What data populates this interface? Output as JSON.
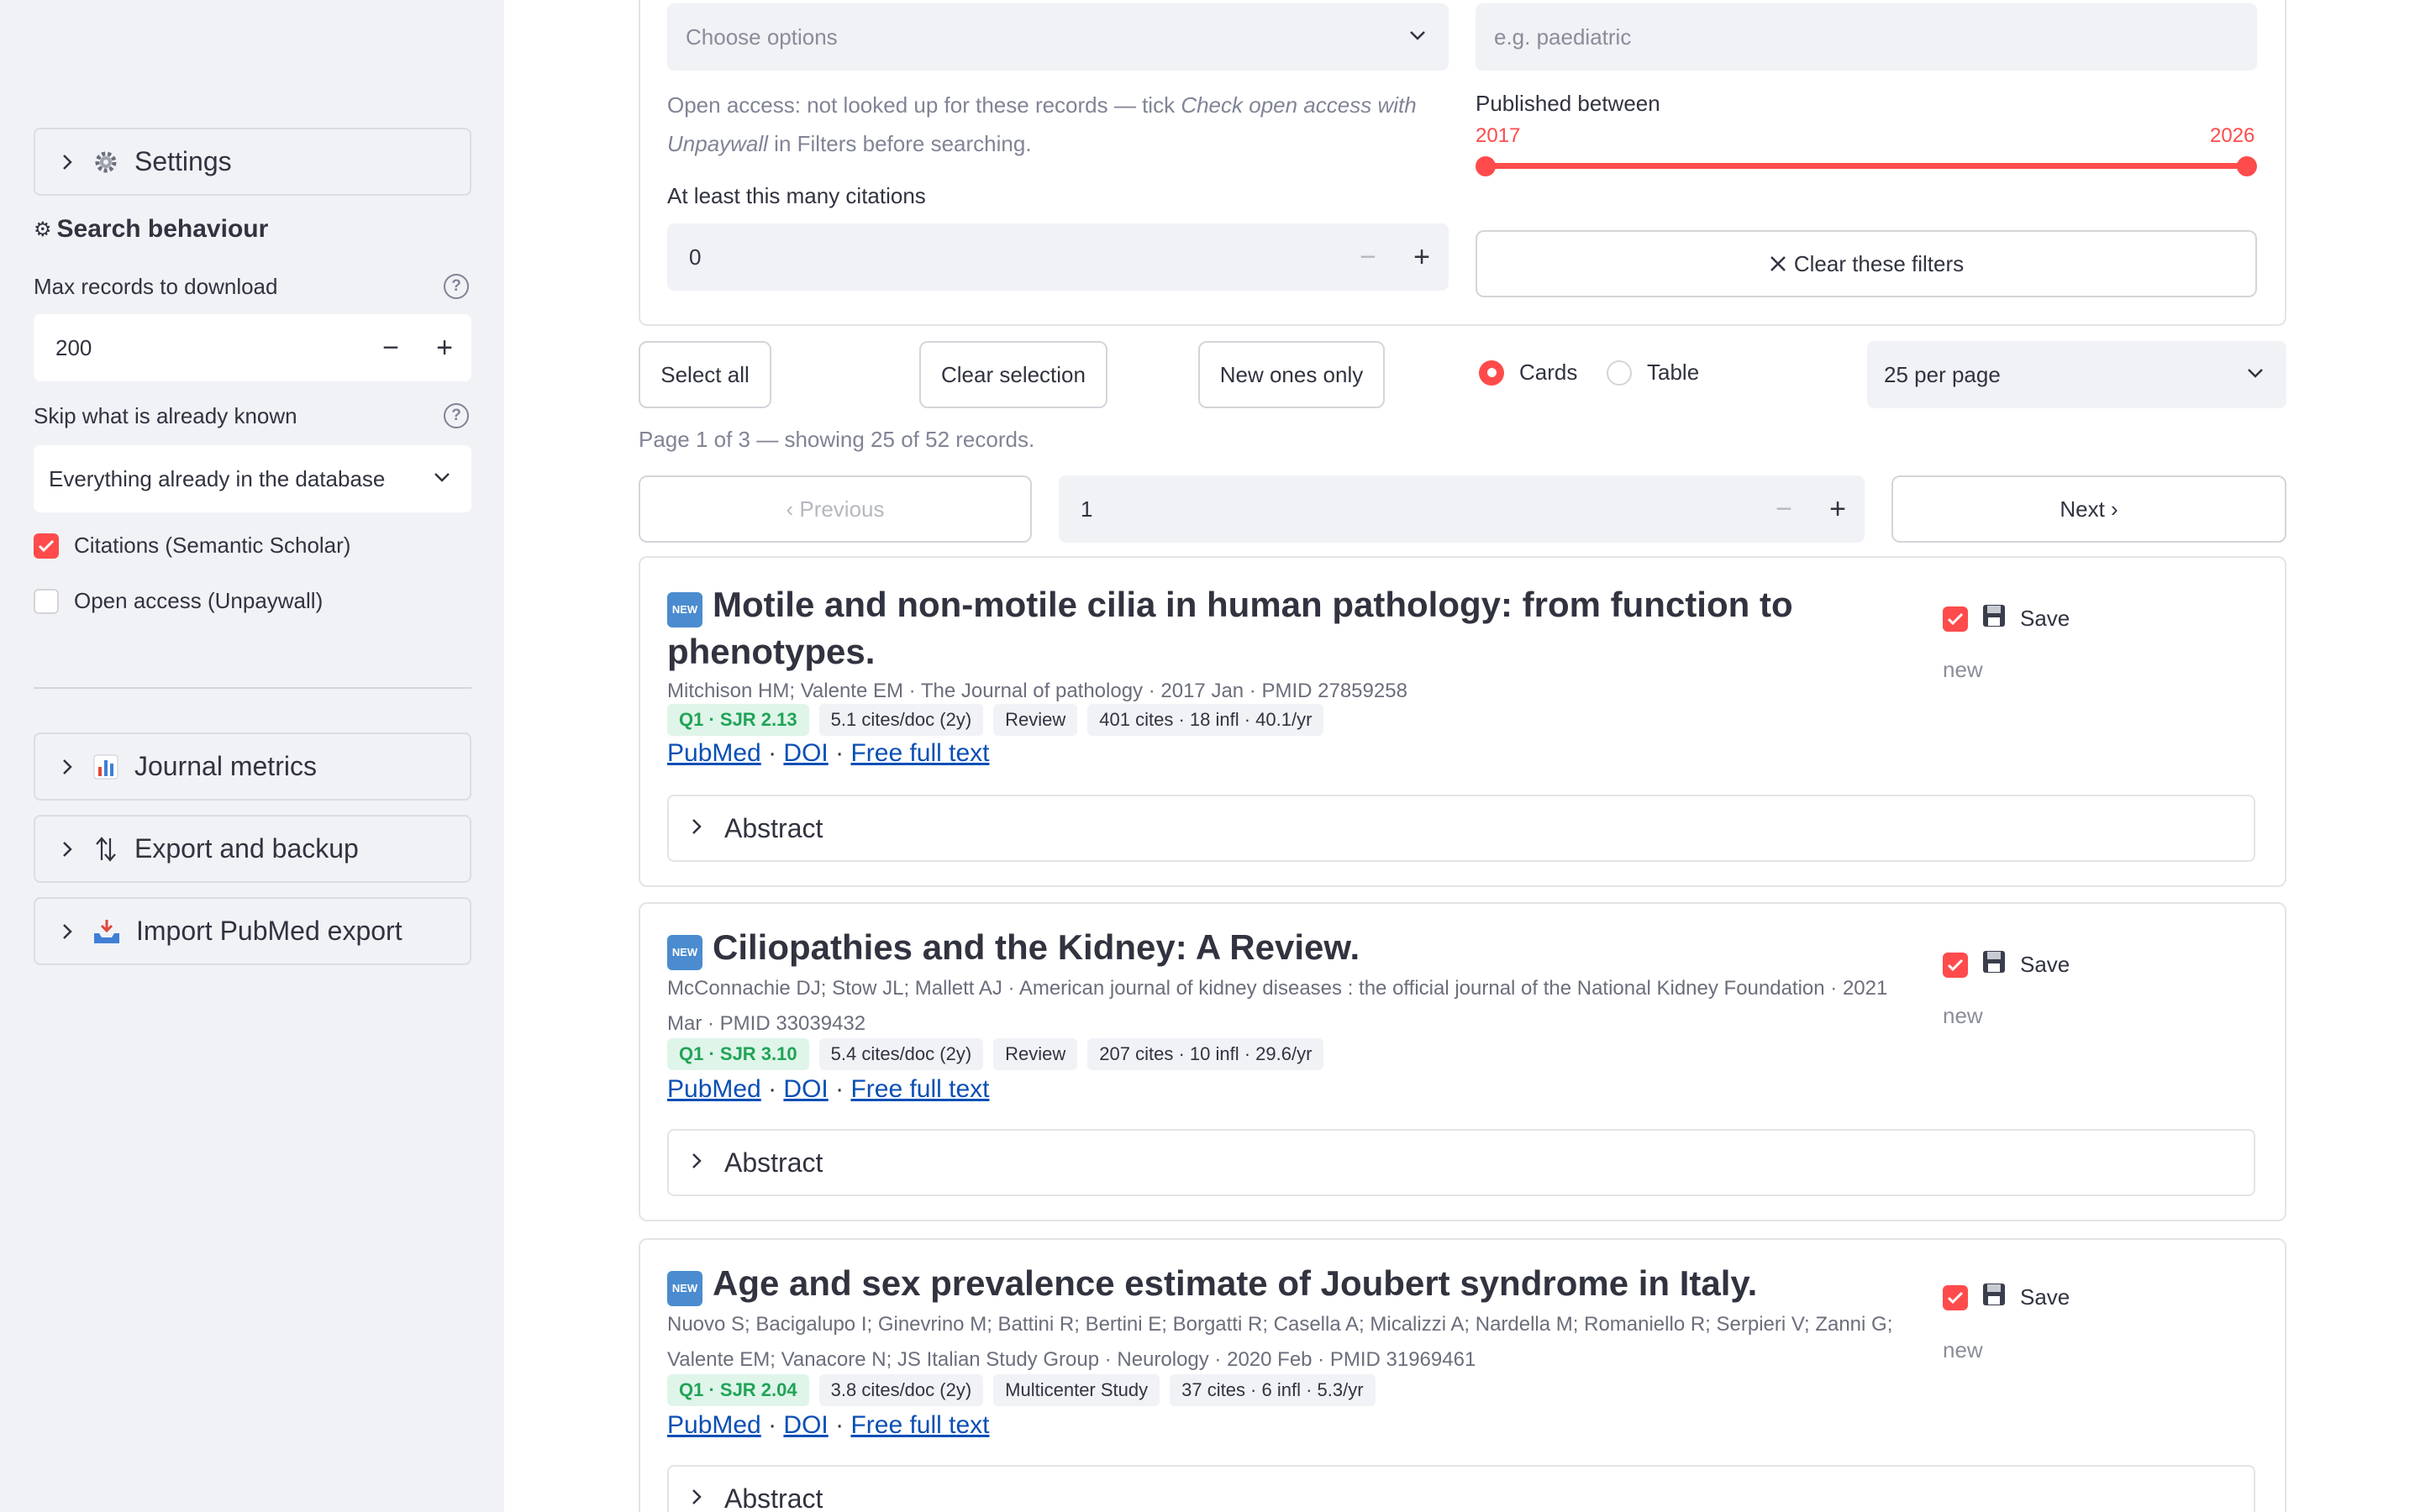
{
  "sidebar": {
    "settings_label": "Settings",
    "search_heading": "Search behaviour",
    "max_records_label": "Max records to download",
    "max_records_value": "200",
    "skip_label": "Skip what is already known",
    "skip_value": "Everything already in the database",
    "citations_label": "Citations (Semantic Scholar)",
    "citations_checked": true,
    "oa_label": "Open access (Unpaywall)",
    "oa_checked": false,
    "expanders": [
      {
        "label": "Journal metrics",
        "icon": "bar-chart-icon"
      },
      {
        "label": "Export and backup",
        "icon": "up-down-arrows-icon"
      },
      {
        "label": "Import PubMed export",
        "icon": "inbox-tray-icon"
      }
    ]
  },
  "filters": {
    "options_placeholder": "Choose options",
    "text_placeholder": "e.g. paediatric",
    "oa_note_prefix": "Open access: not looked up for these records — tick ",
    "oa_note_italic": "Check open access with Unpaywall",
    "oa_note_suffix": " in Filters before searching.",
    "published_label": "Published between",
    "year_min": "2017",
    "year_max": "2026",
    "citations_label": "At least this many citations",
    "citations_value": "0",
    "clear_label": "Clear these filters"
  },
  "toolbar": {
    "select_all": "Select all",
    "clear_selection": "Clear selection",
    "new_only": "New ones only",
    "view_cards": "Cards",
    "view_table": "Table",
    "per_page": "25 per page"
  },
  "pagination": {
    "status": "Page 1 of 3 — showing 25 of 52 records.",
    "previous": "‹ Previous",
    "next": "Next ›",
    "page_value": "1"
  },
  "records": [
    {
      "badge": "NEW",
      "title": "Motile and non-motile cilia in human pathology: from function to phenotypes.",
      "meta": "Mitchison HM; Valente EM · The Journal of pathology · 2017 Jan · PMID 27859258",
      "quartile": "Q1 · SJR 2.13",
      "cites_doc": "5.1 cites/doc (2y)",
      "type": "Review",
      "cites": "401 cites · 18 infl · 40.1/yr",
      "link_pubmed": "PubMed",
      "link_doi": "DOI",
      "link_fulltext": "Free full text",
      "abstract": "Abstract",
      "save": "Save",
      "status": "new"
    },
    {
      "badge": "NEW",
      "title": "Ciliopathies and the Kidney: A Review.",
      "meta": "McConnachie DJ; Stow JL; Mallett AJ · American journal of kidney diseases : the official journal of the National Kidney Foundation · 2021 Mar · PMID 33039432",
      "quartile": "Q1 · SJR 3.10",
      "cites_doc": "5.4 cites/doc (2y)",
      "type": "Review",
      "cites": "207 cites · 10 infl · 29.6/yr",
      "link_pubmed": "PubMed",
      "link_doi": "DOI",
      "link_fulltext": "Free full text",
      "abstract": "Abstract",
      "save": "Save",
      "status": "new"
    },
    {
      "badge": "NEW",
      "title": "Age and sex prevalence estimate of Joubert syndrome in Italy.",
      "meta": "Nuovo S; Bacigalupo I; Ginevrino M; Battini R; Bertini E; Borgatti R; Casella A; Micalizzi A; Nardella M; Romaniello R; Serpieri V; Zanni G; Valente EM; Vanacore N; JS Italian Study Group · Neurology · 2020 Feb · PMID 31969461",
      "quartile": "Q1 · SJR 2.04",
      "cites_doc": "3.8 cites/doc (2y)",
      "type": "Multicenter Study",
      "cites": "37 cites · 6 infl · 5.3/yr",
      "link_pubmed": "PubMed",
      "link_doi": "DOI",
      "link_fulltext": "Free full text",
      "abstract": "Abstract",
      "save": "Save",
      "status": "new"
    }
  ]
}
